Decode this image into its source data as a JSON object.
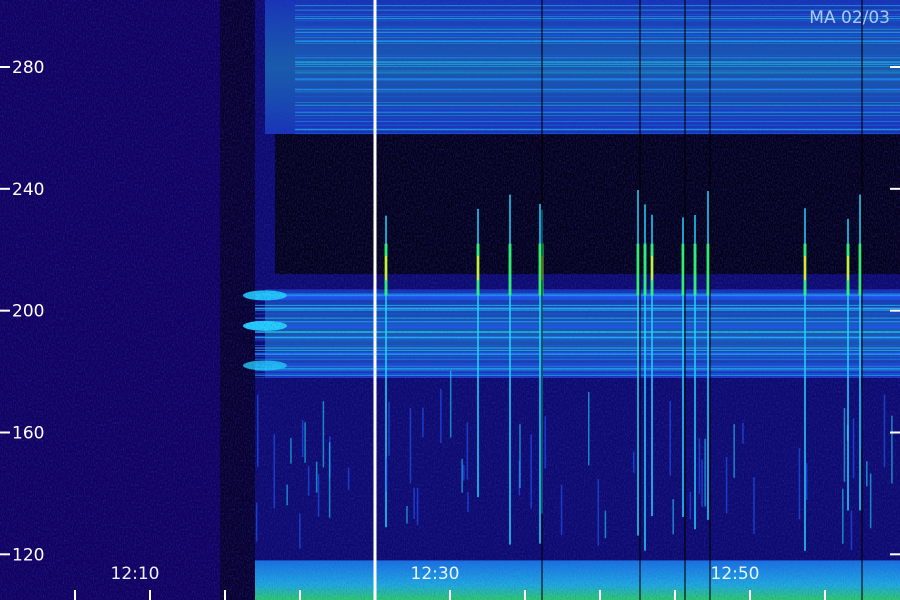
{
  "chart_data": {
    "type": "heatmap",
    "title": "MA 02/03",
    "ylim": [
      105,
      302
    ],
    "y_ticks": [
      120,
      160,
      200,
      240,
      280
    ],
    "y_tick_labels": [
      "120",
      "160",
      "200",
      "240",
      "280"
    ],
    "x_time_labels": [
      {
        "label": "12:10",
        "minute": 10
      },
      {
        "label": "12:30",
        "minute": 30
      },
      {
        "label": "12:50",
        "minute": 50
      }
    ],
    "xlim_minutes": [
      1,
      61
    ],
    "x_minor_tick_minutes": [
      6,
      11,
      16,
      21,
      26,
      31,
      36,
      41,
      46,
      51,
      56
    ],
    "marker_line_minute": 26,
    "bright_bands": [
      {
        "from": 178,
        "to": 207,
        "level": 0.55
      },
      {
        "from": 258,
        "to": 302,
        "level": 0.55
      },
      {
        "from": 105,
        "to": 118,
        "level": 0.8
      }
    ],
    "colors": {
      "background": "#000000",
      "low": "#14006e",
      "mid": "#1f5cff",
      "high": "#22d4ff",
      "peak_green": "#35ff6a",
      "peak_yellow": "#ffe11f",
      "axis": "#ffffff"
    }
  }
}
